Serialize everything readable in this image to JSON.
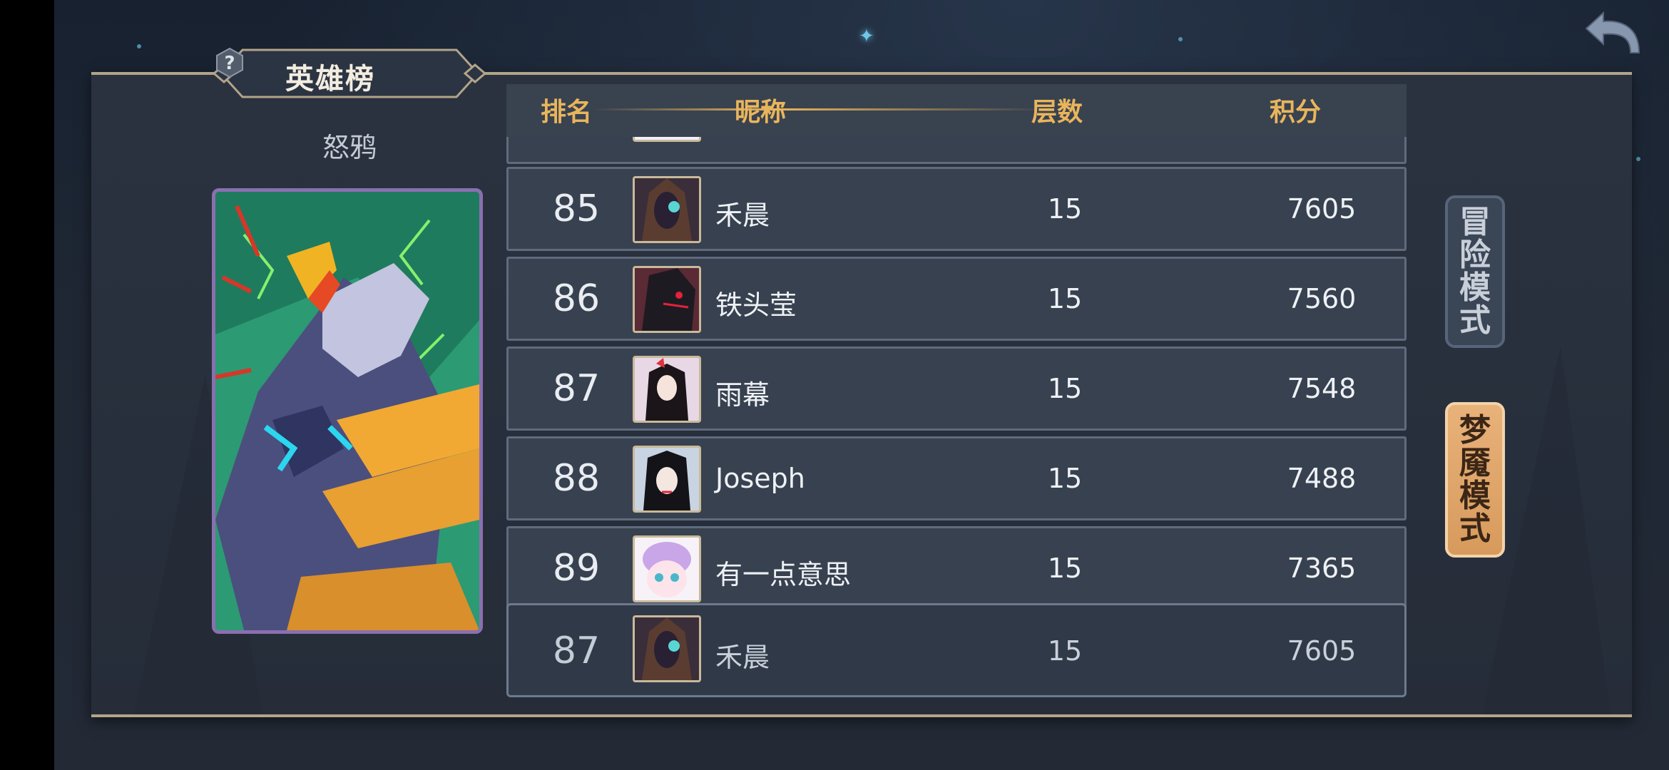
{
  "title": "英雄榜",
  "hero": {
    "name": "怒鸦"
  },
  "table": {
    "headers": {
      "rank": "排名",
      "nickname": "昵称",
      "floor": "层数",
      "score": "积分"
    },
    "rows": [
      {
        "rank": "85",
        "nickname": "禾晨",
        "floor": "15",
        "score": "7605"
      },
      {
        "rank": "86",
        "nickname": "铁头莹",
        "floor": "15",
        "score": "7560"
      },
      {
        "rank": "87",
        "nickname": "雨幕",
        "floor": "15",
        "score": "7548"
      },
      {
        "rank": "88",
        "nickname": "Joseph",
        "floor": "15",
        "score": "7488"
      },
      {
        "rank": "89",
        "nickname": "有一点意思",
        "floor": "15",
        "score": "7365"
      }
    ],
    "my_row": {
      "rank": "87",
      "nickname": "禾晨",
      "floor": "15",
      "score": "7605"
    }
  },
  "modes": [
    {
      "label": "冒险模式",
      "chars": [
        "冒",
        "险",
        "模",
        "式"
      ],
      "selected": false
    },
    {
      "label": "梦魇模式",
      "chars": [
        "梦",
        "魇",
        "模",
        "式"
      ],
      "selected": true
    }
  ],
  "icons": [
    "back-arrow-icon",
    "help-icon"
  ],
  "colors": {
    "accent_gold": "#e9b55c",
    "panel": "#2a3240",
    "selected_mode": "#e2a96b"
  }
}
